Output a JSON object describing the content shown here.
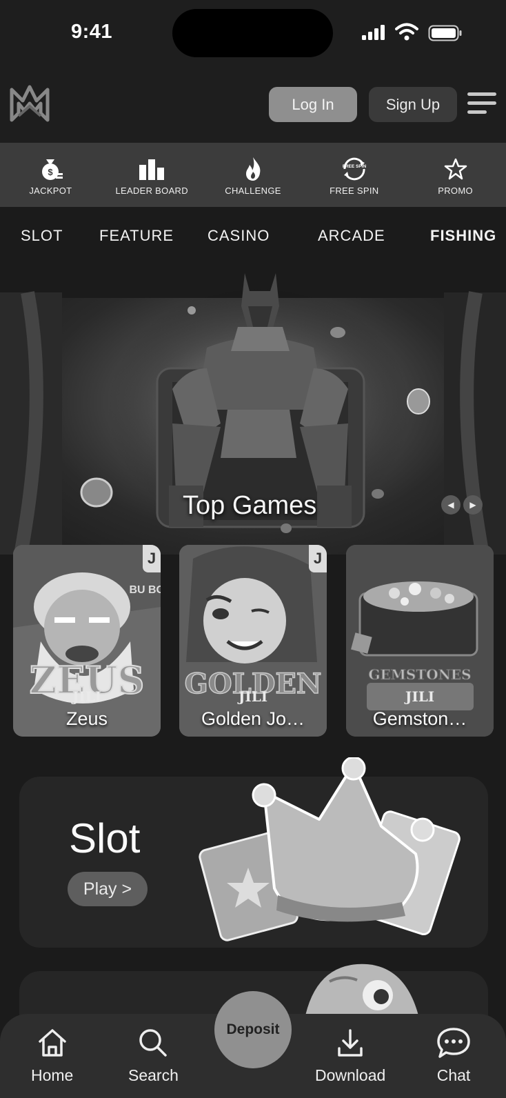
{
  "status": {
    "time": "9:41"
  },
  "header": {
    "login_label": "Log In",
    "signup_label": "Sign Up"
  },
  "quickbar": [
    {
      "label": "JACKPOT",
      "icon": "money-bag-icon"
    },
    {
      "label": "LEADER BOARD",
      "icon": "bar-chart-icon"
    },
    {
      "label": "CHALLENGE",
      "icon": "flame-icon"
    },
    {
      "label": "FREE SPIN",
      "icon": "free-spin-icon",
      "icon_text": "FREE SPIN"
    },
    {
      "label": "PROMO",
      "icon": "star-icon"
    }
  ],
  "tabs": [
    "SLOT",
    "FEATURE",
    "CASINO",
    "ARCADE",
    "FISHING"
  ],
  "hero": {
    "title": "Top Games",
    "prev": "◀",
    "next": "▶"
  },
  "games": [
    {
      "name": "Zeus",
      "brand": "JILI",
      "art_text": "ZEUS",
      "badge": "J",
      "corner_text": "BU BON"
    },
    {
      "name": "Golden Jo…",
      "brand": "JILI",
      "art_text": "GOLDEN",
      "badge": "J"
    },
    {
      "name": "Gemston…",
      "brand": "JILI",
      "art_text": "GEMSTONES"
    }
  ],
  "promos": [
    {
      "title": "Slot",
      "button": "Play >"
    }
  ],
  "bottom_nav": [
    {
      "label": "Home",
      "icon": "home-icon"
    },
    {
      "label": "Search",
      "icon": "search-icon"
    },
    {
      "label": "Download",
      "icon": "download-icon"
    },
    {
      "label": "Chat",
      "icon": "chat-icon"
    }
  ],
  "deposit_label": "Deposit"
}
